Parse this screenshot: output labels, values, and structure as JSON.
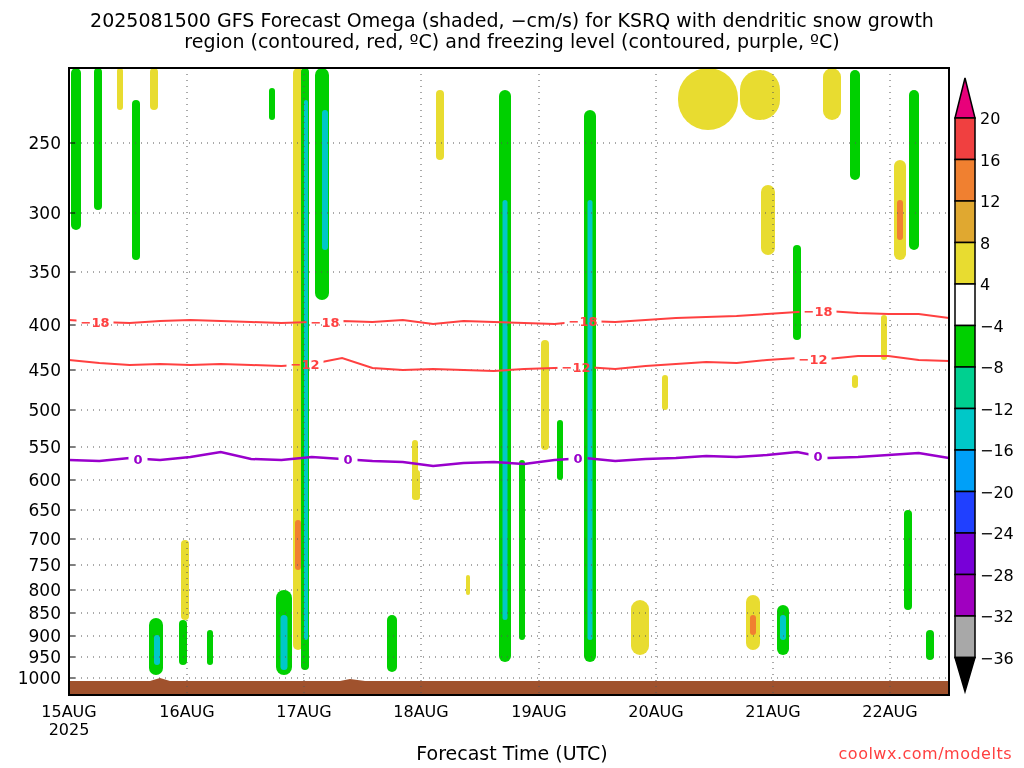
{
  "title": "2025081500 GFS Forecast Omega (shaded, −cm/s) for KSRQ with dendritic snow growth region (contoured, red, ºC) and freezing level (contoured, purple, ºC)",
  "plot": {
    "y_ticks": [
      "250",
      "300",
      "350",
      "400",
      "450",
      "500",
      "550",
      "600",
      "650",
      "700",
      "750",
      "800",
      "850",
      "900",
      "950",
      "1000"
    ],
    "x_ticks": [
      {
        "label": "15AUG",
        "sublabel": "2025"
      },
      {
        "label": "16AUG"
      },
      {
        "label": "17AUG"
      },
      {
        "label": "18AUG"
      },
      {
        "label": "19AUG"
      },
      {
        "label": "20AUG"
      },
      {
        "label": "21AUG"
      },
      {
        "label": "22AUG"
      }
    ],
    "contours": [
      {
        "kind": "dgz",
        "color": "#ff4040",
        "labels": [
          "−18",
          "−18",
          "−18",
          "−18"
        ]
      },
      {
        "kind": "dgz",
        "color": "#ff4040",
        "labels": [
          "−12",
          "−12",
          "−12"
        ]
      },
      {
        "kind": "freezing",
        "color": "#9900cc",
        "labels": [
          "0",
          "0",
          "0",
          "0"
        ]
      }
    ],
    "xlabel": "Forecast Time (UTC)"
  },
  "colorbar": {
    "labels": [
      "20",
      "16",
      "12",
      "8",
      "4",
      "−4",
      "−8",
      "−12",
      "−16",
      "−20",
      "−24",
      "−28",
      "−32",
      "−36"
    ],
    "bins": [
      {
        "kind": "arrow",
        "color": "#e8007a"
      },
      {
        "kind": "box",
        "color": "#f04040"
      },
      {
        "kind": "box",
        "color": "#f08030"
      },
      {
        "kind": "box",
        "color": "#e0a830"
      },
      {
        "kind": "box",
        "color": "#e8dc30"
      },
      {
        "kind": "box",
        "color": "#ffffff"
      },
      {
        "kind": "box",
        "color": "#00d000"
      },
      {
        "kind": "box",
        "color": "#00d090"
      },
      {
        "kind": "box",
        "color": "#00c8c8"
      },
      {
        "kind": "box",
        "color": "#00a0f8"
      },
      {
        "kind": "box",
        "color": "#2040ff"
      },
      {
        "kind": "box",
        "color": "#7800d8"
      },
      {
        "kind": "box",
        "color": "#a000c0"
      },
      {
        "kind": "box",
        "color": "#a8a8a8"
      },
      {
        "kind": "arrow",
        "color": "#000000"
      }
    ]
  },
  "credit": "coolwx.com/modelts"
}
